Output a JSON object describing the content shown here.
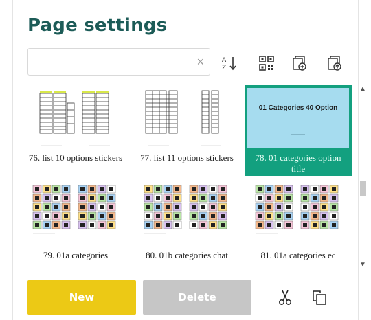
{
  "dialog": {
    "title": "Page settings"
  },
  "search": {
    "value": "",
    "placeholder": "",
    "clear_icon": "×"
  },
  "toolbar": {
    "icons": [
      "sort-az-icon",
      "qr-code-icon",
      "add-page-icon",
      "upload-page-icon"
    ]
  },
  "pages": [
    {
      "label": "76. list 10 options stickers",
      "selected": false,
      "thumb": "list"
    },
    {
      "label": "77. list 11 options stickers",
      "selected": false,
      "thumb": "list2"
    },
    {
      "label": "78. 01 categories option title",
      "selected": true,
      "thumb": "title",
      "thumb_text": "01 Categories 40 Option"
    },
    {
      "label": "79. 01a categories",
      "selected": false,
      "thumb": "grid"
    },
    {
      "label": "80. 01b categories chat",
      "selected": false,
      "thumb": "grid"
    },
    {
      "label": "81. 01a categories ec",
      "selected": false,
      "thumb": "grid"
    }
  ],
  "actions": {
    "new_label": "New",
    "delete_label": "Delete",
    "cut_icon": "scissors-icon",
    "copy_icon": "copy-icon"
  },
  "colors": {
    "title": "#1c5b57",
    "selected_tile": "#13a07f",
    "new_button": "#ecc915",
    "delete_button": "#c6c6c6",
    "selected_thumb_bg": "#a6dcef"
  }
}
